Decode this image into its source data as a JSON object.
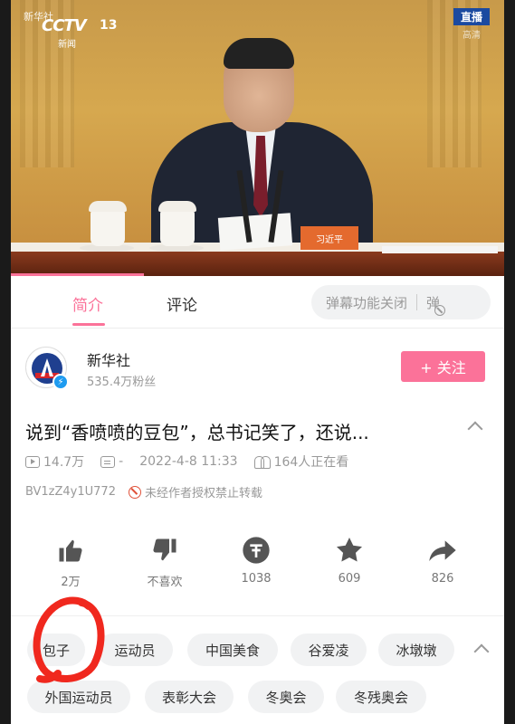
{
  "video": {
    "watermark_xinhua": "新华社",
    "cctv_logo": "CCTV",
    "channel_number": "13",
    "channel_name": "新闻",
    "live_badge": "直播",
    "hd_label": "高清",
    "nameplate": "习近平",
    "progress_fraction": 0.27
  },
  "tabs": {
    "intro": "简介",
    "comments": "评论",
    "danmaku_toggle": "弹幕功能关闭",
    "danmaku_icon_glyph": "弹"
  },
  "uploader": {
    "name": "新华社",
    "fans": "535.4万粉丝",
    "follow_label": "+ 关注"
  },
  "video_info": {
    "title": "说到“香喷喷的豆包”，总书记笑了，还说...",
    "views": "14.7万",
    "danmaku_count": "-",
    "date": "2022-4-8 11:33",
    "watching": "164人正在看",
    "bvid": "BV1zZ4y1U772",
    "copyright_notice": "未经作者授权禁止转载"
  },
  "actions": {
    "like": "2万",
    "dislike": "不喜欢",
    "coin": "1038",
    "favorite": "609",
    "share": "826"
  },
  "tags": {
    "row1": [
      "包子",
      "运动员",
      "中国美食",
      "谷爱凌",
      "冰墩墩"
    ],
    "row2": [
      "外国运动员",
      "表彰大会",
      "冬奥会",
      "冬残奥会"
    ]
  },
  "colors": {
    "accent": "#fb7299",
    "annotation": "#f0281e"
  }
}
